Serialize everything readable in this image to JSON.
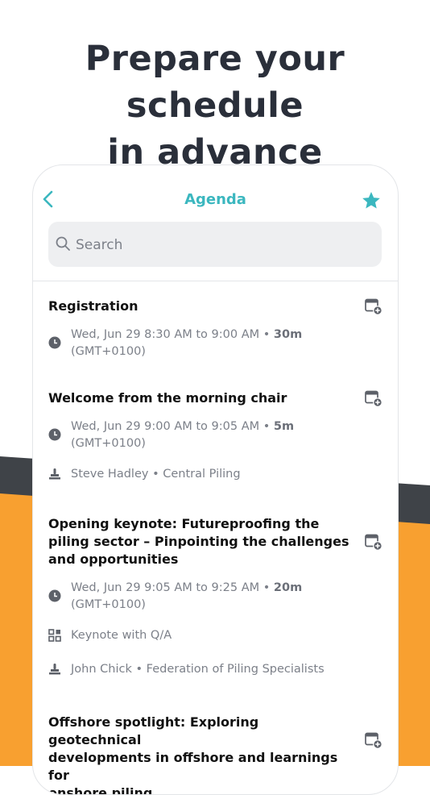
{
  "headline": {
    "line1": "Prepare your schedule",
    "line2": "in advance"
  },
  "nav": {
    "title": "Agenda"
  },
  "search": {
    "placeholder": "Search"
  },
  "sessions": [
    {
      "title_lines": [
        "Registration"
      ],
      "time": "Wed, Jun 29 8:30 AM to 9:00 AM",
      "duration": "30m",
      "timezone": "(GMT+0100)"
    },
    {
      "title_lines": [
        "Welcome from the morning chair"
      ],
      "time": "Wed, Jun 29 9:00 AM to 9:05 AM",
      "duration": "5m",
      "timezone": "(GMT+0100)",
      "speaker": "Steve Hadley",
      "organisation": "Central Piling"
    },
    {
      "title_lines": [
        "Opening keynote: Futureproofing the",
        "piling sector – Pinpointing the challenges",
        "and opportunities"
      ],
      "time": "Wed, Jun 29 9:05 AM to 9:25 AM",
      "duration": "20m",
      "timezone": "(GMT+0100)",
      "format": "Keynote with Q/A",
      "speaker": "John Chick",
      "organisation": "Federation of Piling Specialists"
    },
    {
      "title_lines": [
        "Offshore spotlight: Exploring geotechnical",
        "developments in offshore and learnings for",
        "onshore piling"
      ]
    }
  ],
  "colors": {
    "accent": "#3bb7bf",
    "orange": "#f8a030",
    "dark": "#3f4348",
    "headline": "#2a2f3a"
  },
  "icons": [
    "chevron-left-icon",
    "star-icon",
    "search-icon",
    "calendar-add-icon",
    "clock-icon",
    "speaker-icon",
    "format-grid-icon"
  ]
}
